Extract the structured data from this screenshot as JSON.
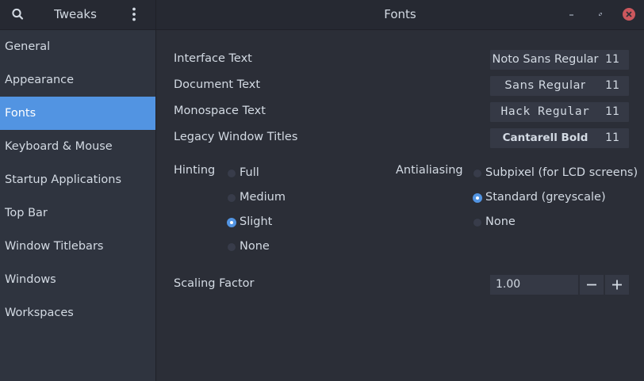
{
  "header": {
    "app_title": "Tweaks",
    "page_title": "Fonts"
  },
  "sidebar": {
    "items": [
      {
        "label": "General"
      },
      {
        "label": "Appearance"
      },
      {
        "label": "Fonts"
      },
      {
        "label": "Keyboard & Mouse"
      },
      {
        "label": "Startup Applications"
      },
      {
        "label": "Top Bar"
      },
      {
        "label": "Window Titlebars"
      },
      {
        "label": "Windows"
      },
      {
        "label": "Workspaces"
      }
    ],
    "selected": "Fonts"
  },
  "fonts": {
    "interface": {
      "label": "Interface Text",
      "font": "Noto Sans Regular",
      "size": "11"
    },
    "document": {
      "label": "Document Text",
      "font": "Sans Regular",
      "size": "11"
    },
    "monospace": {
      "label": "Monospace Text",
      "font": "Hack Regular",
      "size": "11"
    },
    "legacy": {
      "label": "Legacy Window Titles",
      "font": "Cantarell Bold",
      "size": "11"
    }
  },
  "hinting": {
    "label": "Hinting",
    "options": [
      "Full",
      "Medium",
      "Slight",
      "None"
    ],
    "selected": "Slight"
  },
  "antialiasing": {
    "label": "Antialiasing",
    "options": [
      "Subpixel (for LCD screens)",
      "Standard (greyscale)",
      "None"
    ],
    "selected": "Standard (greyscale)"
  },
  "scaling": {
    "label": "Scaling Factor",
    "value": "1.00"
  },
  "icons": {
    "search": "search-icon",
    "menu": "vertical-dots-icon",
    "minimize": "minimize-icon",
    "maximize": "maximize-icon",
    "close": "close-icon",
    "minus": "minus-icon",
    "plus": "plus-icon"
  },
  "colors": {
    "accent": "#5294e2",
    "close": "#cc575d",
    "background": "#2b2e37",
    "sidebar": "#2f343f"
  }
}
